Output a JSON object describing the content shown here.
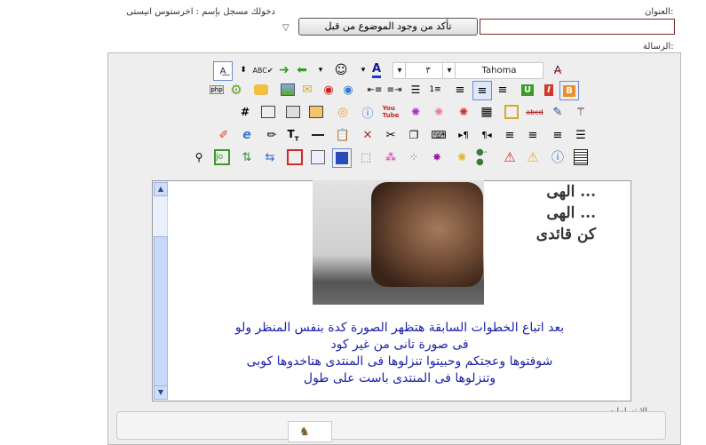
{
  "form": {
    "title_label": "العنوان:",
    "logged_in_text": "دخولك مسجل بإسم : اخرستوس انيستى",
    "check_button": "تأكد من وجود الموضوع من قبل",
    "message_label": "الرسالة:",
    "smilies_label": "الابتسامات"
  },
  "toolbar": {
    "font_name": "Tahoma",
    "font_size": "۳"
  },
  "editor": {
    "image_lines": [
      "الهى ...",
      "الهى ...",
      "كن قائدى"
    ],
    "lines": [
      "بعد اتباع الخطوات السابقة  هتظهر الصورة كدة بنفس المنظر  ولو",
      "فى صورة تانى من غير كود",
      "شوفتوها وعجتكم وحبيتوا تنزلوها فى المنتدى هتاخدوها كوبى",
      "وتنزلوها فى المنتدى باست على طول"
    ]
  },
  "colors": {
    "text_blue": "#1b23a8",
    "panel_bg": "#eeeeee",
    "title_border": "#7a2a2a"
  }
}
